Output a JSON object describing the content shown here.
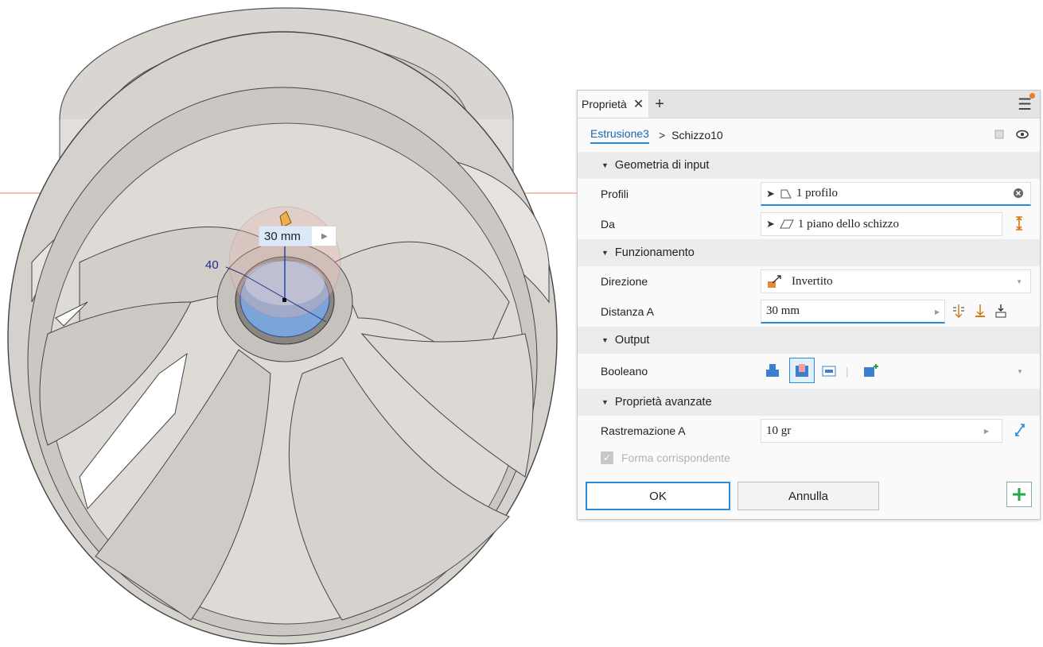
{
  "viewport": {
    "dimension_value": "30 mm",
    "diameter_label": "40"
  },
  "panel": {
    "tab_label": "Proprietà",
    "breadcrumb": {
      "feature": "Estrusione3",
      "sketch": "Schizzo10"
    },
    "sections": {
      "input": "Geometria di input",
      "operation": "Funzionamento",
      "output": "Output",
      "advanced": "Proprietà avanzate"
    },
    "fields": {
      "profiles_label": "Profili",
      "profiles_value": "1 profilo",
      "from_label": "Da",
      "from_value": "1 piano dello schizzo",
      "direction_label": "Direzione",
      "direction_value": "Invertito",
      "distance_label": "Distanza A",
      "distance_value": "30 mm",
      "boolean_label": "Booleano",
      "taper_label": "Rastremazione A",
      "taper_value": "10 gr",
      "match_shape_label": "Forma corrispondente"
    },
    "buttons": {
      "ok": "OK",
      "cancel": "Annulla"
    },
    "colors": {
      "accent": "#2a8bd8",
      "notification": "#f07a1f",
      "add": "#2aa64a"
    }
  }
}
